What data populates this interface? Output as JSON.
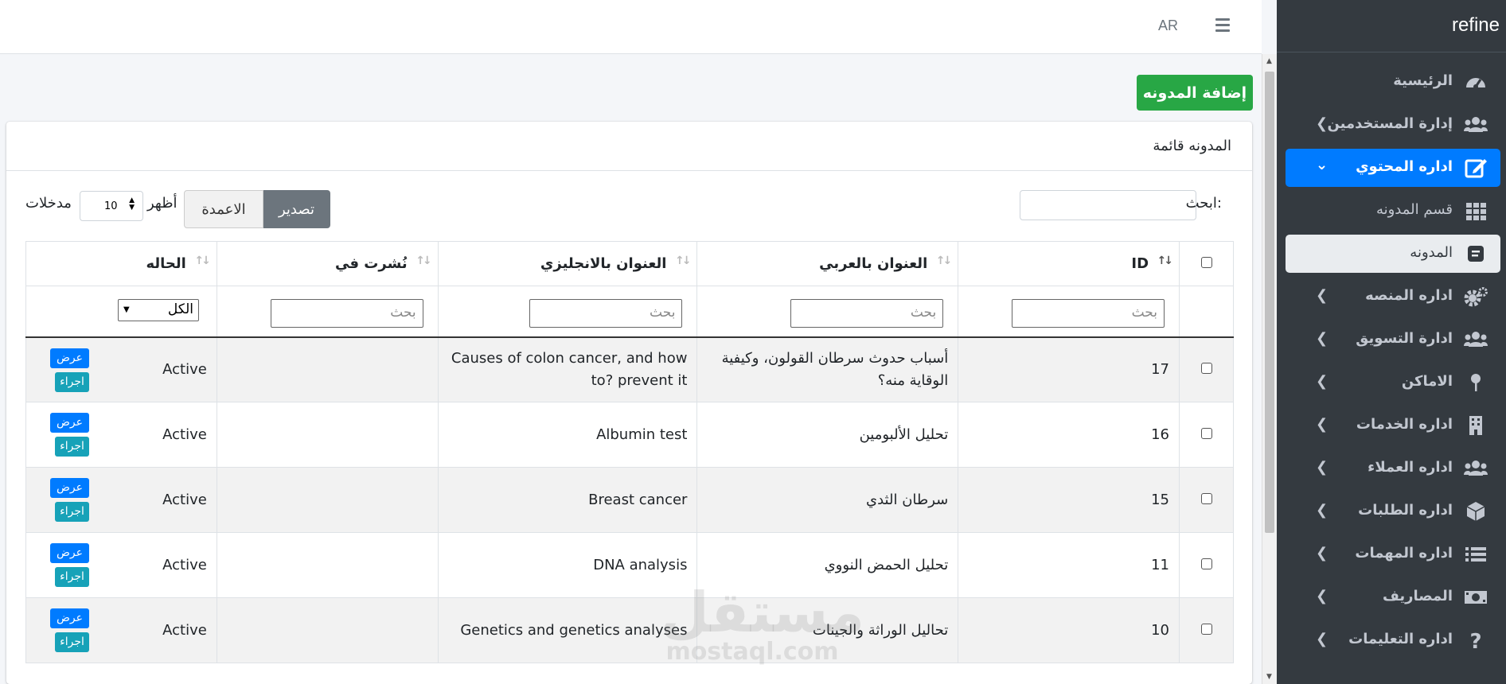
{
  "navbar": {
    "lang": "AR"
  },
  "sidebar": {
    "brand": "refine",
    "items": [
      {
        "label": "الرئيسية",
        "icon": "dashboard-icon",
        "chevron": false
      },
      {
        "label": "إدارة المستخدمين",
        "icon": "users-icon",
        "chevron": true
      },
      {
        "label": "اداره المحتوي",
        "icon": "edit-icon",
        "chevron": true,
        "active": true
      },
      {
        "label": "قسم المدونه",
        "icon": "grid-icon",
        "sub": true
      },
      {
        "label": "المدونه",
        "icon": "blog-icon",
        "sub": true,
        "selected": true
      },
      {
        "label": "اداره المنصه",
        "icon": "cogs-icon",
        "chevron": true
      },
      {
        "label": "ادارة التسويق",
        "icon": "users-icon",
        "chevron": true
      },
      {
        "label": "الاماكن",
        "icon": "map-pin-icon",
        "chevron": true
      },
      {
        "label": "اداره الخدمات",
        "icon": "building-icon",
        "chevron": true
      },
      {
        "label": "اداره العملاء",
        "icon": "users-icon",
        "chevron": true
      },
      {
        "label": "اداره الطلبات",
        "icon": "box-icon",
        "chevron": true
      },
      {
        "label": "اداره المهمات",
        "icon": "list-icon",
        "chevron": true
      },
      {
        "label": "المصاريف",
        "icon": "money-icon",
        "chevron": true
      },
      {
        "label": "اداره التعليمات",
        "icon": "question-icon",
        "chevron": true
      }
    ]
  },
  "main": {
    "add_button": "إضافة المدونه",
    "card_title": "المدونه قائمة",
    "search_label": "ابحث:",
    "export_button": "تصدير",
    "columns_button": "الاعمدة",
    "show_label": "أظهر",
    "page_length": "10",
    "entries_label": "مدخلات",
    "filter_placeholder": "بحث",
    "status_filter": "الكل",
    "table": {
      "headers": {
        "id": "ID",
        "title_ar": "العنوان بالعربي",
        "title_en": "العنوان بالانجليزي",
        "published": "نُشرت في",
        "status": "الحاله"
      },
      "rows": [
        {
          "id": "17",
          "title_ar": "أسباب حدوث سرطان القولون، وكيفية الوقاية منه؟",
          "title_en": "Causes of colon cancer, and how to? prevent it",
          "published": "",
          "status": "Active"
        },
        {
          "id": "16",
          "title_ar": "تحليل الألبومين",
          "title_en": "Albumin test",
          "published": "",
          "status": "Active"
        },
        {
          "id": "15",
          "title_ar": "سرطان الثدي",
          "title_en": "Breast cancer",
          "published": "",
          "status": "Active"
        },
        {
          "id": "11",
          "title_ar": "تحليل الحمض النووي",
          "title_en": "DNA analysis",
          "published": "",
          "status": "Active"
        },
        {
          "id": "10",
          "title_ar": "تحاليل الوراثة والجينات",
          "title_en": "Genetics and genetics analyses",
          "published": "",
          "status": "Active"
        }
      ],
      "view_button": "عرض",
      "action_button": "اجراء"
    }
  },
  "watermark": {
    "ar": "مستقل",
    "en": "mostaql.com"
  },
  "colors": {
    "sidebar_bg": "#343a40",
    "primary": "#007bff",
    "success": "#28a745",
    "info": "#17a2b8",
    "secondary": "#6c757d"
  }
}
